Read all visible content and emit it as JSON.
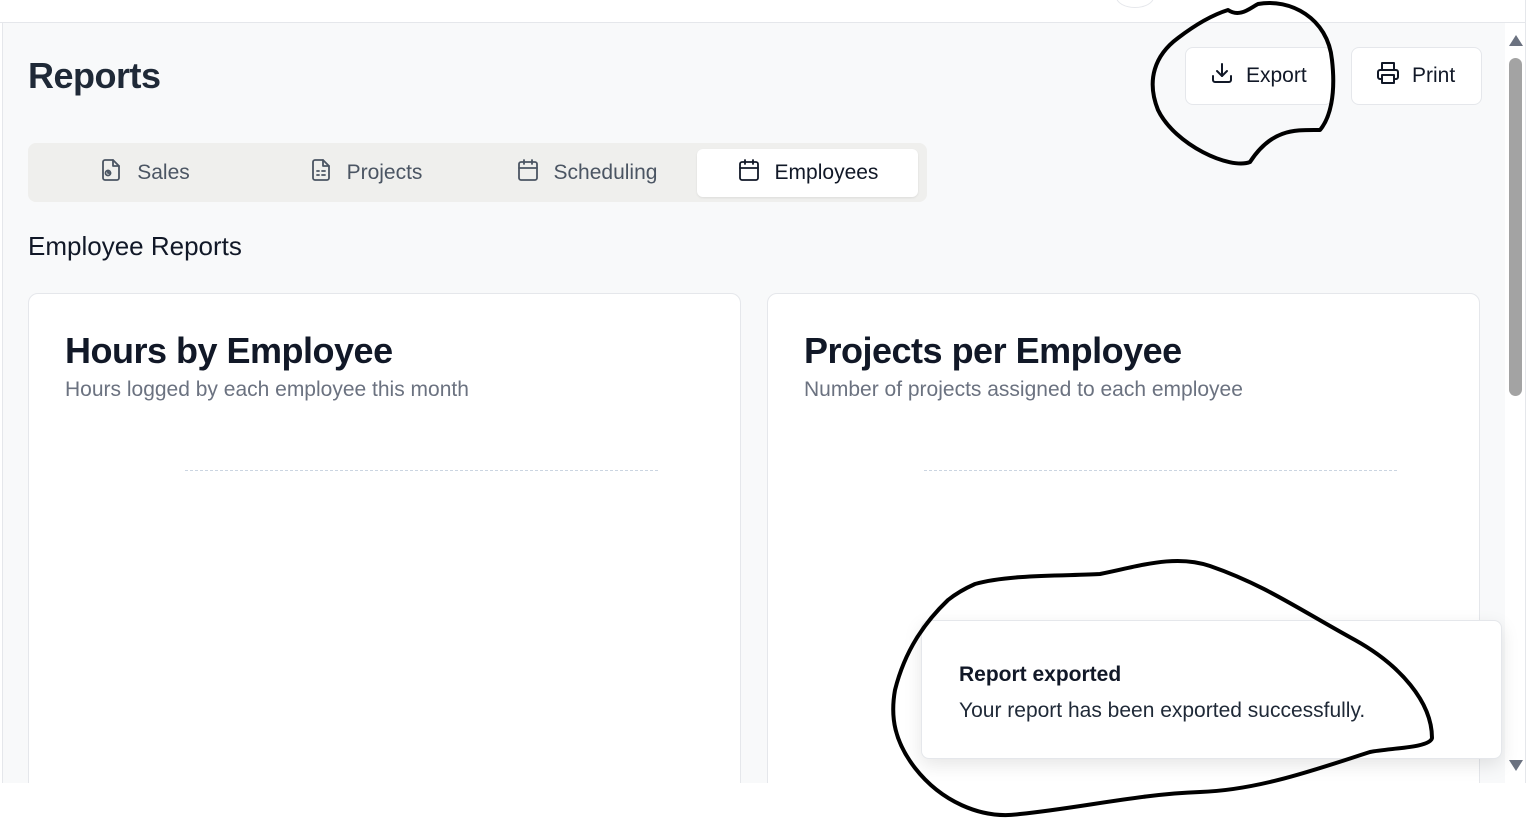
{
  "page": {
    "title": "Reports",
    "section_title": "Employee Reports"
  },
  "toolbar": {
    "export_label": "Export",
    "print_label": "Print"
  },
  "tabs": [
    {
      "label": "Sales",
      "icon": "file-chart-icon",
      "active": false
    },
    {
      "label": "Projects",
      "icon": "file-text-icon",
      "active": false
    },
    {
      "label": "Scheduling",
      "icon": "calendar-icon",
      "active": false
    },
    {
      "label": "Employees",
      "icon": "calendar-icon",
      "active": true
    }
  ],
  "cards": [
    {
      "title": "Hours by Employee",
      "subtitle": "Hours logged by each employee this month"
    },
    {
      "title": "Projects per Employee",
      "subtitle": "Number of projects assigned to each employee"
    }
  ],
  "toast": {
    "title": "Report exported",
    "description": "Your report has been exported successfully."
  },
  "colors": {
    "page_background": "#f8f9fa",
    "card_background": "#ffffff",
    "tab_bar_background": "#efefed",
    "text_primary": "#111827",
    "text_muted": "#6b7280",
    "annotation_ink": "#000000"
  }
}
